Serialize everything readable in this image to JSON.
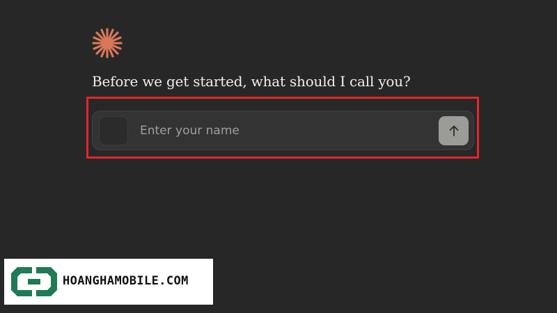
{
  "brand": {
    "icon": "asterisk-logo-icon",
    "accent_color": "#d9775a"
  },
  "onboarding": {
    "prompt": "Before we get started, what should I call you?"
  },
  "name_input": {
    "placeholder": "Enter your name",
    "value": "",
    "submit_icon": "arrow-up-icon"
  },
  "highlight": {
    "color": "#e3262a"
  },
  "watermark": {
    "text": "HOANGHAMOBILE.COM",
    "icon": "hoanghamobile-logo-icon",
    "color": "#1f7a55"
  }
}
